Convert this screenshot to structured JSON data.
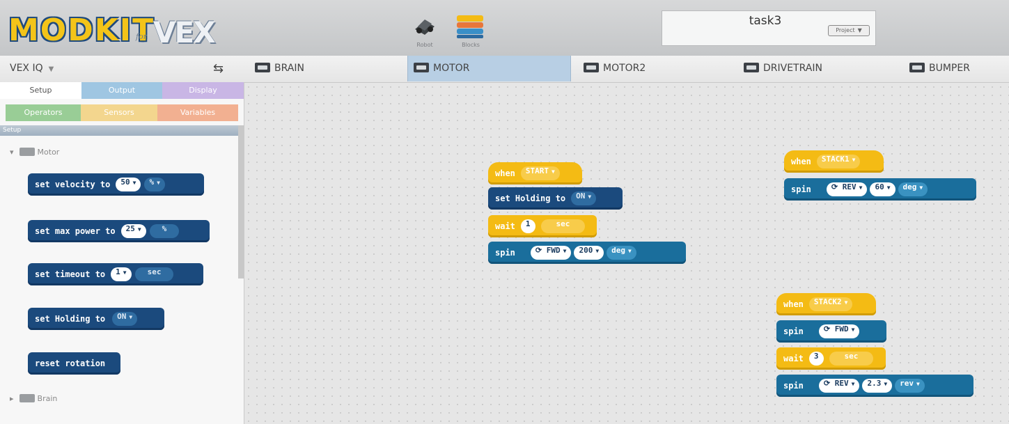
{
  "header": {
    "logo_text": "MODKIT",
    "logo_for": "for",
    "logo_vex": "VEX",
    "robot_label": "Robot",
    "blocks_label": "Blocks",
    "project_name": "task3",
    "project_button": "Project"
  },
  "device_bar": {
    "platform": "VEX IQ",
    "tabs": [
      {
        "label": "BRAIN",
        "icon": "brain-icon"
      },
      {
        "label": "MOTOR",
        "icon": "motor-icon"
      },
      {
        "label": "MOTOR2",
        "icon": "motor-icon"
      },
      {
        "label": "DRIVETRAIN",
        "icon": "drivetrain-icon"
      },
      {
        "label": "BUMPER",
        "icon": "bumper-icon"
      }
    ],
    "active_tab": "MOTOR"
  },
  "sidebar": {
    "tabs_row1": [
      "Setup",
      "Output",
      "Display"
    ],
    "tabs_row2": [
      "Operators",
      "Sensors",
      "Variables"
    ],
    "section": "Setup",
    "motor_label": "Motor",
    "brain_label": "Brain",
    "blocks": {
      "b1": {
        "text": "set velocity to",
        "v1": "50",
        "v2": "%"
      },
      "b2": {
        "text": "set max power to",
        "v1": "25",
        "v2": "%"
      },
      "b3": {
        "text": "set timeout to",
        "v1": "1",
        "v2": "sec"
      },
      "b4": {
        "text": "set Holding to",
        "v1": "ON"
      },
      "b5": {
        "text": "reset rotation"
      }
    }
  },
  "canvas": {
    "stack1": {
      "when": "when",
      "event": "START",
      "holding": "set Holding to",
      "holding_val": "ON",
      "wait": "wait",
      "wait_val": "1",
      "wait_unit": "sec",
      "spin": "spin",
      "dir": "FWD",
      "amount": "200",
      "unit": "deg"
    },
    "stack2": {
      "when": "when",
      "event": "STACK1",
      "spin": "spin",
      "dir": "REV",
      "amount": "60",
      "unit": "deg"
    },
    "stack3": {
      "when": "when",
      "event": "STACK2",
      "spin1": "spin",
      "dir1": "FWD",
      "wait": "wait",
      "wait_val": "3",
      "wait_unit": "sec",
      "spin2": "spin",
      "dir2": "REV",
      "amount": "2.3",
      "unit": "rev"
    }
  }
}
